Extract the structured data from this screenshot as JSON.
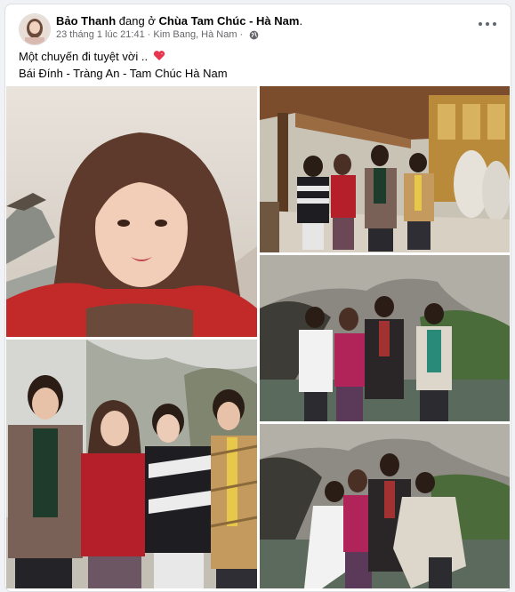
{
  "post": {
    "author": "Bảo Thanh",
    "checkin_connector": "đang ở",
    "location": "Chùa Tam Chúc - Hà Nam",
    "location_suffix": ".",
    "timestamp": "23 tháng 1 lúc 21:41",
    "place": "Kim Bang, Hà Nam",
    "separator": "·",
    "privacy_icon": "globe-icon",
    "more_icon": "more-options-icon",
    "caption_line1": "Một chuyến đi tuyệt vời ..",
    "caption_emoji": "heart-icon",
    "caption_line2": "Bái Đính - Tràng An - Tam Chúc Hà Nam"
  },
  "colors": {
    "text": "#050505",
    "meta": "#65676b",
    "heart": "#e8364f",
    "card": "#ffffff",
    "page": "#f0f2f5"
  },
  "photos": [
    "selfie-photo",
    "temple-corridor-photo",
    "cliff-lake-photo",
    "group-hug-photo",
    "family-group-photo"
  ]
}
